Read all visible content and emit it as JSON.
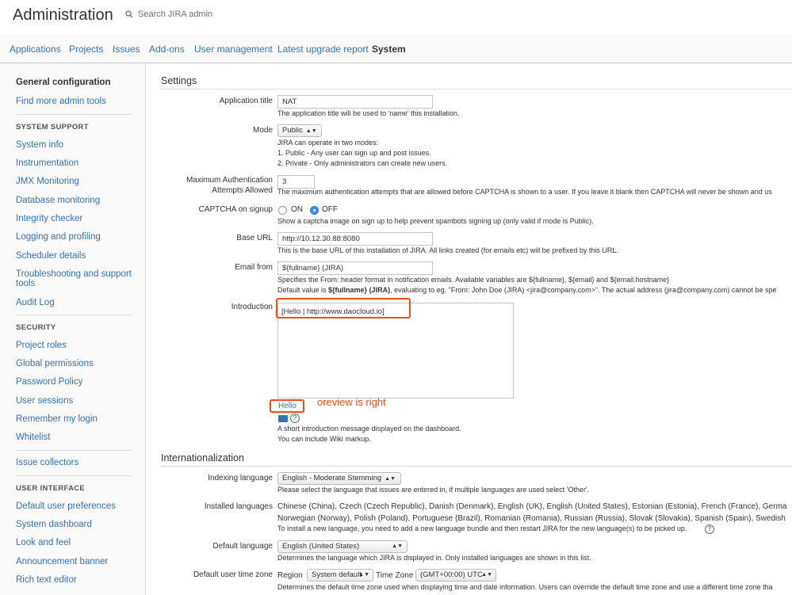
{
  "header": {
    "title": "Administration",
    "search_placeholder": "Search JIRA admin"
  },
  "nav": {
    "tabs": [
      {
        "label": "Applications"
      },
      {
        "label": "Projects"
      },
      {
        "label": "Issues"
      },
      {
        "label": "Add-ons"
      },
      {
        "label": "User management"
      },
      {
        "label": "Latest upgrade report"
      },
      {
        "label": "System",
        "active": true
      }
    ]
  },
  "sidebar": {
    "general": "General configuration",
    "find_more": "Find more admin tools",
    "system_support_heading": "SYSTEM SUPPORT",
    "system_support": [
      "System info",
      "Instrumentation",
      "JMX Monitoring",
      "Database monitoring",
      "Integrity checker",
      "Logging and profiling",
      "Scheduler details",
      "Troubleshooting and support",
      "tools",
      "Audit Log"
    ],
    "security_heading": "SECURITY",
    "security": [
      "Project roles",
      "Global permissions",
      "Password Policy",
      "User sessions",
      "Remember my login",
      "Whitelist"
    ],
    "issue_collectors": "Issue collectors",
    "ui_heading": "USER INTERFACE",
    "ui": [
      "Default user preferences",
      "System dashboard",
      "Look and feel",
      "Announcement banner",
      "Rich text editor"
    ]
  },
  "settings": {
    "heading": "Settings",
    "app_title_label": "Application title",
    "app_title_value": "NAT",
    "app_title_desc": "The application title will be used to 'name' this installation.",
    "mode_label": "Mode",
    "mode_value": "Public",
    "mode_desc": [
      "JIRA can operate in two modes:",
      "1. Public - Any user can sign up and post issues.",
      "2. Private - Only administrators can create new users."
    ],
    "max_auth_label1": "Maximum Authentication",
    "max_auth_label2": "Attempts Allowed",
    "max_auth_value": "3",
    "max_auth_desc": "The maximum authentication attempts that are allowed before CAPTCHA is shown to a user. If you leave it blank then CAPTCHA will never be shown and us",
    "captcha_label": "CAPTCHA on signup",
    "captcha_on": "ON",
    "captcha_off": "OFF",
    "captcha_desc": "Show a captcha image on sign up to help prevent spambots signing up (only valid if mode is Public).",
    "base_url_label": "Base URL",
    "base_url_value": "http://10.12.30.88:8080",
    "base_url_desc": "This is the base URL of this installation of JIRA. All links created (for emails etc) will be prefixed by this URL.",
    "email_from_label": "Email from",
    "email_from_value": "${fullname} (JIRA)",
    "email_from_desc1": "Specifies the From: header format in notification emails. Available variables are ${fullname}, ${email} and ${email.hostname}",
    "email_from_desc2a": "Default value is ",
    "email_from_desc2b": "${fullname} (JIRA)",
    "email_from_desc2c": ", evaluating to eg. \"From: John Doe (JIRA) <jira@company.com>\". The actual address (jira@company.com) cannot be spe",
    "intro_label": "Introduction",
    "intro_value": "[Hello | http://www.daocloud.io]",
    "intro_preview": "Hello",
    "annotation": "oreview is right",
    "intro_desc1": "A short introduction message displayed on the dashboard.",
    "intro_desc2": "You can include Wiki markup."
  },
  "i18n": {
    "heading": "Internationalization",
    "indexing_label": "Indexing language",
    "indexing_value": "English - Moderate Stemming",
    "indexing_desc": "Please select the language that issues are entered in, if multiple languages are used select 'Other'.",
    "installed_label": "Installed languages",
    "installed_line1": "Chinese (China), Czech (Czech Republic), Danish (Denmark), English (UK), English (United States), Estonian (Estonia), French (France), Germa",
    "installed_line2": "Norwegian (Norway), Polish (Poland), Portuguese (Brazil), Romanian (Romania), Russian (Russia), Slovak (Slovakia), Spanish (Spain), Swedish",
    "installed_line3": "To install a new language, you need to add a new language bundle and then restart JIRA for the new language(s) to be picked up.",
    "default_lang_label": "Default language",
    "default_lang_value": "English (United States)",
    "default_lang_desc": "Determines the language which JIRA is displayed in. Only installed languages are shown in this list.",
    "tz_label": "Default user time zone",
    "region_label": "Region",
    "region_value": "System default",
    "tz_sub_label": "Time Zone",
    "tz_value": "(GMT+00:00) UTC",
    "tz_desc": "Determines the default time zone used when displaying time and date information. Users can override the default time zone and use a different time zone tha"
  },
  "colors": {
    "link": "#3572b0",
    "annotation": "#e8501c",
    "radio_on": "#3d8bff"
  }
}
